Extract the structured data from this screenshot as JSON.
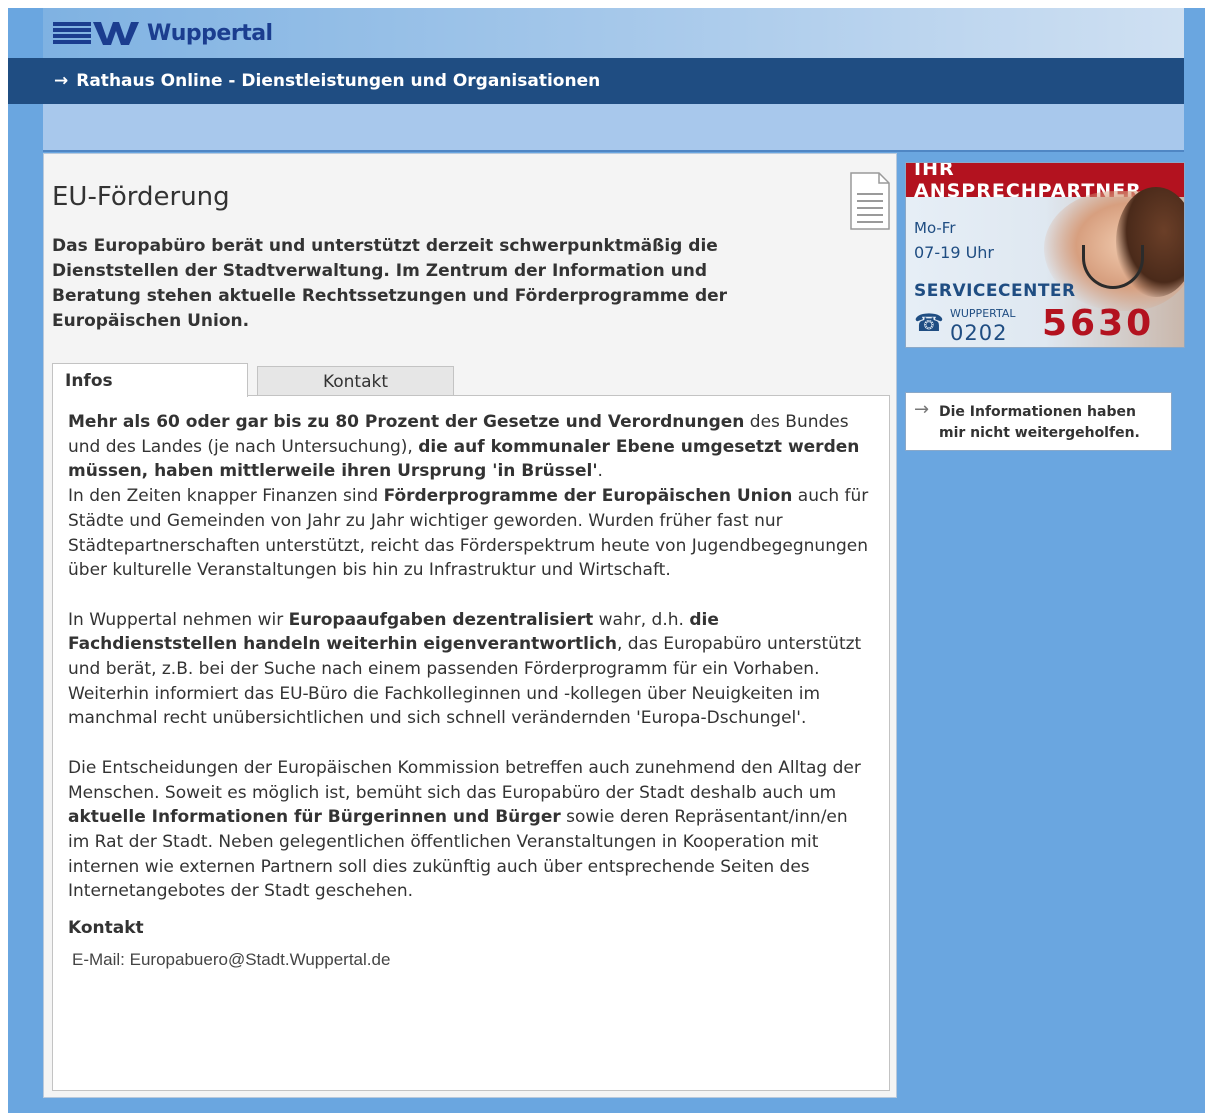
{
  "header": {
    "logo_text": "Wuppertal"
  },
  "nav": {
    "arrow": "→",
    "title": "Rathaus Online - Dienstleistungen und Organisationen"
  },
  "main": {
    "title": "EU-Förderung",
    "intro": "Das Europabüro berät und unterstützt derzeit schwerpunktmäßig die Dienststellen der Stadtverwaltung. Im Zentrum der Information und Beratung stehen aktuelle Rechtssetzungen und Förderprogramme der Europäischen Union.",
    "tabs": [
      {
        "label": "Infos",
        "active": true
      },
      {
        "label": "Kontakt",
        "active": false
      }
    ],
    "paragraphs": {
      "p1_b1": "Mehr als 60 oder gar bis zu 80 Prozent der Gesetze und Verordnungen",
      "p1_t1": " des Bundes und des Landes (je nach Untersuchung), ",
      "p1_b2": "die auf kommunaler Ebene umgesetzt werden müssen, haben mittlerweile ihren Ursprung 'in Brüssel'",
      "p1_t2": ".",
      "p1_t3": "In den Zeiten knapper Finanzen sind ",
      "p1_b3": "Förderprogramme der Europäischen Union",
      "p1_t4": " auch für Städte und Gemeinden von Jahr zu Jahr wichtiger geworden. Wurden früher fast nur Städtepartnerschaften unterstützt, reicht das Förderspektrum heute von Jugendbegegnungen über kulturelle Veranstaltungen bis hin zu Infrastruktur und Wirtschaft.",
      "p2_t1": "In Wuppertal nehmen wir ",
      "p2_b1": "Europaaufgaben dezentralisiert",
      "p2_t2": " wahr, d.h. ",
      "p2_b2": "die Fachdienststellen handeln weiterhin eigenverantwortlich",
      "p2_t3": ", das Europabüro unterstützt und berät, z.B. bei der Suche nach einem passenden Förderprogramm für ein Vorhaben. Weiterhin informiert das EU-Büro die Fachkolleginnen und -kollegen über Neuigkeiten im manchmal recht unübersichtlichen und sich schnell verändernden 'Europa-Dschungel'.",
      "p3_t1": "Die Entscheidungen der Europäischen Kommission betreffen auch zunehmend den Alltag der Menschen. Soweit es möglich ist, bemüht sich das Europabüro der Stadt deshalb auch um ",
      "p3_b1": "aktuelle Informationen für Bürgerinnen und Bürger",
      "p3_t2": " sowie deren Repräsentant/inn/en im Rat der Stadt. Neben gelegentlichen öffentlichen Veranstaltungen in Kooperation mit internen wie externen Partnern soll dies zukünftig auch über entsprechende Seiten des Internetangebotes der Stadt geschehen."
    },
    "contact_heading": "Kontakt",
    "email_label": "E-Mail:",
    "email": "Europabuero@Stadt.Wuppertal.de"
  },
  "sidebar": {
    "banner_title": "IHR ANSPRECHPARTNER",
    "hours_days": "Mo-Fr",
    "hours_time": "07-19 Uhr",
    "service_label": "SERVICECENTER",
    "phone_icon": "☎",
    "city": "WUPPERTAL",
    "area_code": "0202",
    "number": "5630",
    "feedback_arrow": "→",
    "feedback": "Die Informationen haben mir nicht weitergeholfen."
  },
  "colors": {
    "nav_bg": "#1f4d82",
    "frame_bg": "#6aa6e0",
    "banner_red": "#b3121f"
  }
}
